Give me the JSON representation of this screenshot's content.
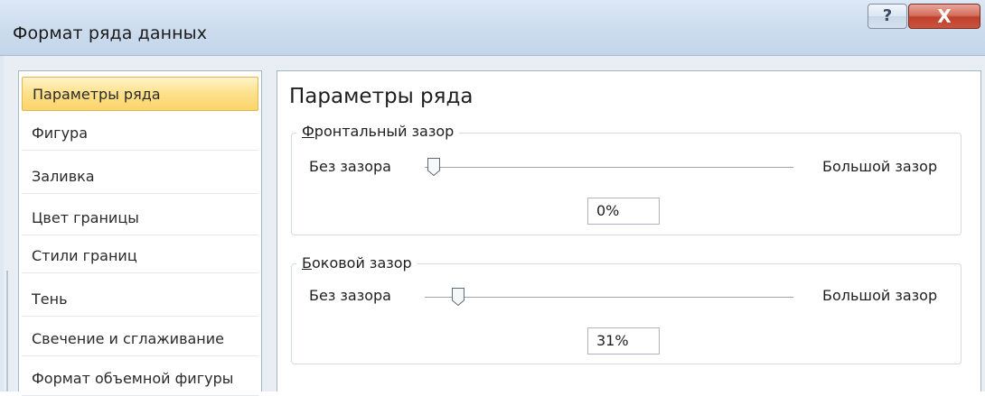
{
  "window": {
    "title": "Формат ряда данных",
    "help_label": "?",
    "close_label": "X"
  },
  "nav": {
    "items": [
      {
        "label": "Параметры ряда",
        "selected": true
      },
      {
        "label": "Фигура",
        "selected": false
      },
      {
        "label": "Заливка",
        "selected": false
      },
      {
        "label": "Цвет границы",
        "selected": false
      },
      {
        "label": "Стили границ",
        "selected": false
      },
      {
        "label": "Тень",
        "selected": false
      },
      {
        "label": "Свечение и сглаживание",
        "selected": false
      },
      {
        "label": "Формат объемной фигуры",
        "selected": false
      }
    ]
  },
  "panel": {
    "title": "Параметры ряда",
    "front_gap": {
      "label_mnemonic": "Ф",
      "label_rest": "ронтальный зазор",
      "min_label": "Без зазора",
      "max_label": "Большой зазор",
      "value": "0%",
      "level": 0.0
    },
    "side_gap": {
      "label_mnemonic": "Б",
      "label_rest": "оковой зазор",
      "min_label": "Без зазора",
      "max_label": "Большой зазор",
      "value": "31%",
      "level": 0.065
    }
  },
  "colors": {
    "selected_item": "#fbd46a",
    "close_button": "#c03f2b",
    "titlebar": "#cfdeef"
  }
}
